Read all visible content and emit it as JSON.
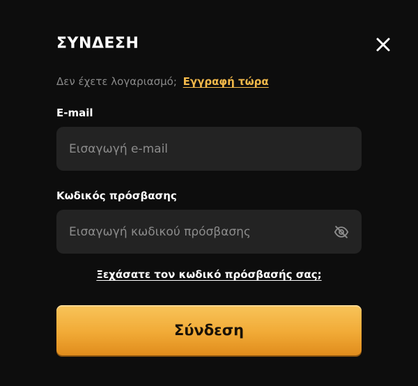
{
  "modal": {
    "title": "ΣΥΝΔΕΣΗ",
    "close_icon": "close-icon"
  },
  "register": {
    "prompt": "Δεν έχετε λογαριασμό;",
    "link_label": "Εγγραφή τώρα"
  },
  "email": {
    "label": "E-mail",
    "placeholder": "Εισαγωγή e-mail",
    "value": ""
  },
  "password": {
    "label": "Κωδικός πρόσβασης",
    "placeholder": "Εισαγωγή κωδικού πρόσβασης",
    "value": "",
    "toggle_icon": "eye-off-icon"
  },
  "forgot_password": {
    "label": "Ξεχάσατε τον κωδικό πρόσβασής σας;"
  },
  "submit": {
    "label": "Σύνδεση"
  },
  "colors": {
    "background": "#0d0d0d",
    "field_background": "#232323",
    "accent": "#f3b94a",
    "button_gradient_top": "#f8c45a",
    "button_gradient_bottom": "#e08c1c"
  }
}
